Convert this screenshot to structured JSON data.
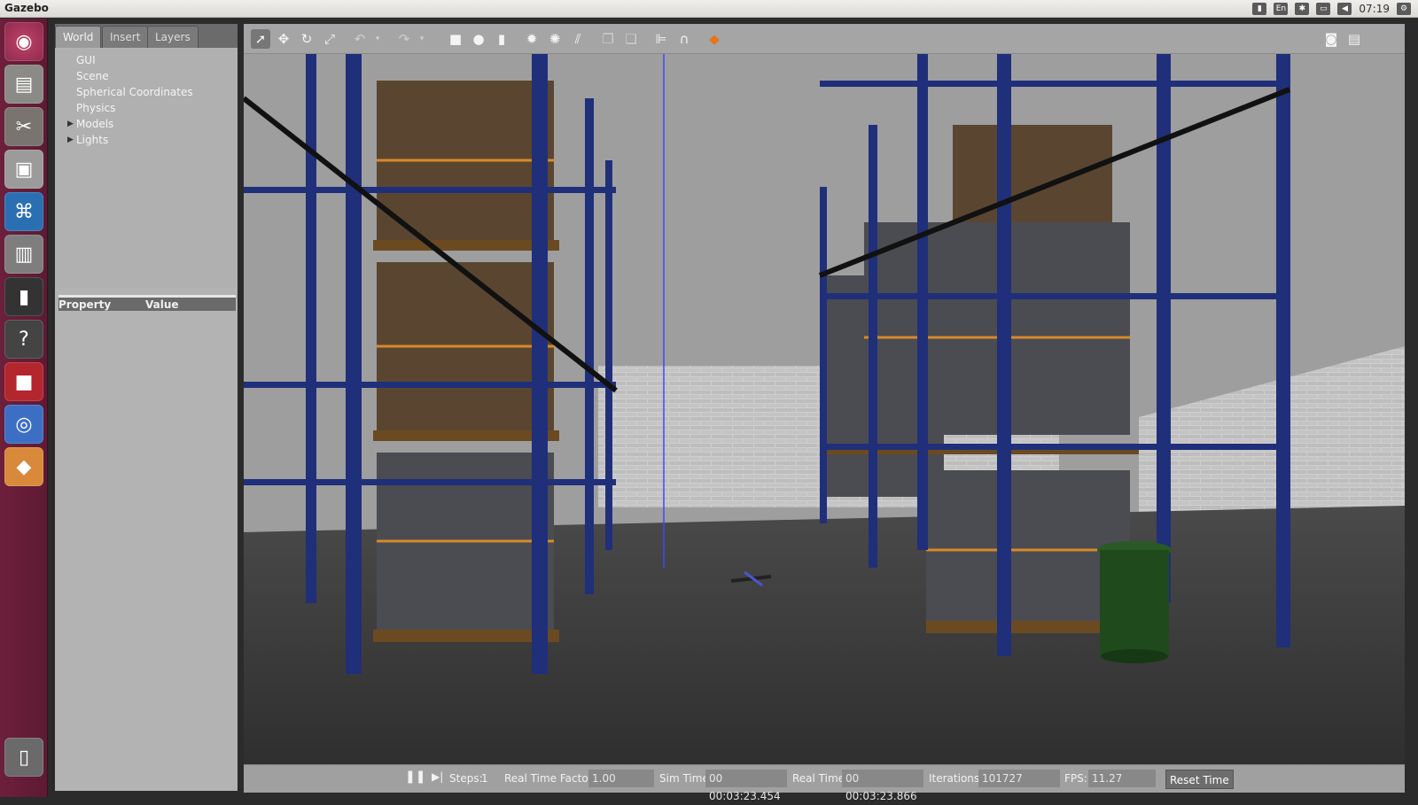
{
  "window": {
    "title": "Gazebo"
  },
  "tray": {
    "keyboard": "En",
    "clock": "07:19"
  },
  "tabs": [
    {
      "label": "World",
      "active": true
    },
    {
      "label": "Insert",
      "active": false
    },
    {
      "label": "Layers",
      "active": false
    }
  ],
  "world_tree": [
    {
      "label": "GUI",
      "expandable": false
    },
    {
      "label": "Scene",
      "expandable": false
    },
    {
      "label": "Spherical Coordinates",
      "expandable": false
    },
    {
      "label": "Physics",
      "expandable": false
    },
    {
      "label": "Models",
      "expandable": true
    },
    {
      "label": "Lights",
      "expandable": true
    }
  ],
  "property_table": {
    "col_property": "Property",
    "col_value": "Value"
  },
  "status": {
    "steps_label": "Steps:",
    "steps_value": "1",
    "rtf_label": "Real Time Factor:",
    "rtf_value": "1.00",
    "sim_time_label": "Sim Time:",
    "sim_time_value": "00 00:03:23.454",
    "real_time_label": "Real Time:",
    "real_time_value": "00 00:03:23.866",
    "iterations_label": "Iterations:",
    "iterations_value": "101727",
    "fps_label": "FPS:",
    "fps_value": "11.27",
    "reset_label": "Reset Time"
  },
  "colors": {
    "launcher": "#6d1f3c",
    "rack_blue": "#1f2f7a",
    "box_brown": "#5a4630",
    "floor": "#3a3a3a",
    "sky": "#a8a8a8",
    "wall": "#c9c9c9",
    "bin_green": "#1f4a1c",
    "grid_line": "#3a4cff",
    "orange_tool": "#e8741c"
  }
}
